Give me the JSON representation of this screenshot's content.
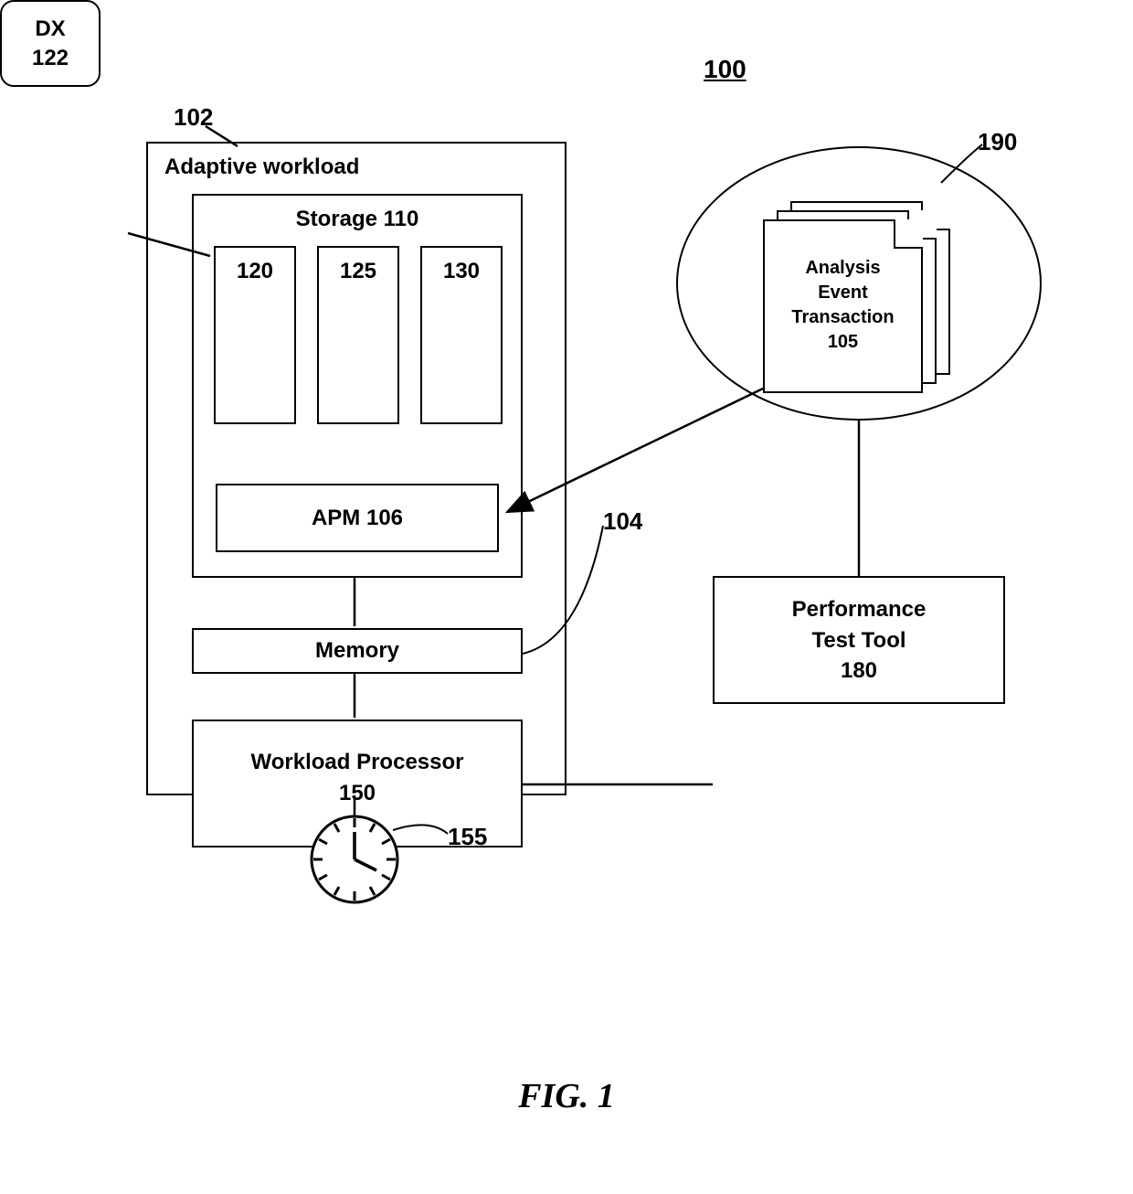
{
  "figure": {
    "system_ref": "100",
    "caption": "FIG. 1"
  },
  "adaptive_workload": {
    "ref": "102",
    "title": "Adaptive workload"
  },
  "dx": {
    "label": "DX",
    "ref": "122"
  },
  "storage": {
    "title": "Storage 110",
    "cols": {
      "c120": "120",
      "c125": "125",
      "c130": "130"
    },
    "apm": "APM 106"
  },
  "memory": {
    "label": "Memory",
    "ref": "104"
  },
  "workload_processor": {
    "label": "Workload Processor",
    "ref": "150"
  },
  "clock": {
    "ref": "155"
  },
  "perf_tool": {
    "label": "Performance\nTest Tool",
    "ref": "180"
  },
  "events": {
    "ref": "190",
    "doc_label": "Analysis\nEvent\nTransaction",
    "doc_ref": "105"
  }
}
